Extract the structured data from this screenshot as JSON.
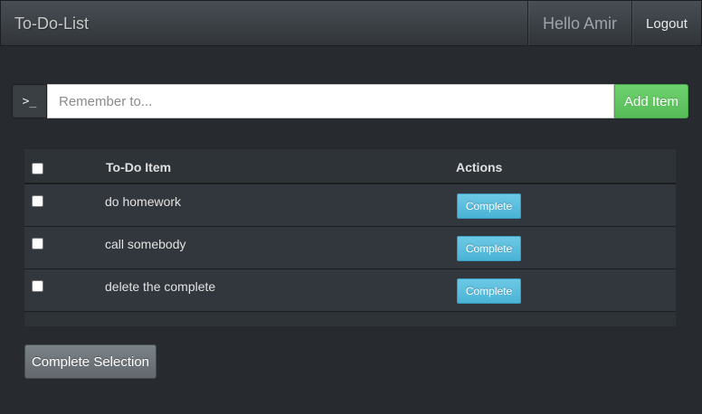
{
  "navbar": {
    "brand": "To-Do-List",
    "greeting": "Hello Amir",
    "logout_label": "Logout"
  },
  "add_form": {
    "addon_symbol": ">_",
    "input_value": "",
    "input_placeholder": "Remember to...",
    "add_button_label": "Add Item"
  },
  "table": {
    "headers": {
      "item": "To-Do Item",
      "actions": "Actions"
    },
    "rows": [
      {
        "item": "do homework",
        "action_label": "Complete",
        "checked": false
      },
      {
        "item": "call somebody",
        "action_label": "Complete",
        "checked": false
      },
      {
        "item": "delete the complete",
        "action_label": "Complete",
        "checked": false
      }
    ]
  },
  "complete_selection_label": "Complete Selection",
  "colors": {
    "background": "#272b30",
    "add_button": "#5cb85c",
    "complete_button": "#5bc0de",
    "secondary_button": "#7a8288"
  },
  "icons": {
    "addon": "terminal-prompt-icon"
  }
}
